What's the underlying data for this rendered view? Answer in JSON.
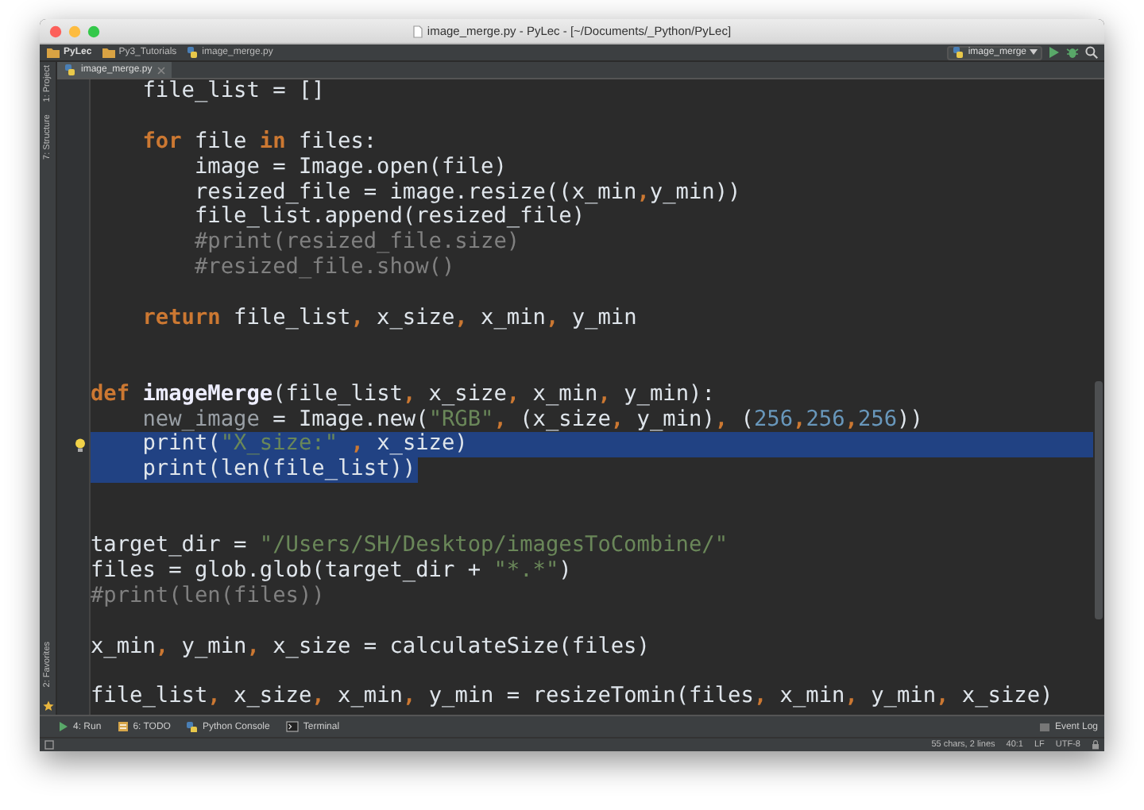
{
  "window": {
    "title": "image_merge.py - PyLec - [~/Documents/_Python/PyLec]"
  },
  "navbar": {
    "breadcrumbs": [
      {
        "label": "PyLec",
        "kind": "folder"
      },
      {
        "label": "Py3_Tutorials",
        "kind": "folder"
      },
      {
        "label": "image_merge.py",
        "kind": "file"
      }
    ],
    "run_config": "image_merge"
  },
  "editor_tabs": [
    {
      "label": "image_merge.py",
      "selected": true
    }
  ],
  "left_tools": {
    "top": [
      "1: Project",
      "7: Structure"
    ],
    "bottom": [
      "2: Favorites"
    ]
  },
  "code": {
    "lines": [
      {
        "selected": false,
        "tokens": [
          {
            "kind": "plain",
            "text": "    file_list = []"
          }
        ]
      },
      {
        "selected": false
      },
      {
        "selected": false,
        "tokens": [
          {
            "kind": "kw",
            "text": "    for"
          },
          {
            "kind": "plain",
            "text": " file "
          },
          {
            "kind": "kw",
            "text": "in"
          },
          {
            "kind": "plain",
            "text": " files:"
          }
        ]
      },
      {
        "selected": false,
        "tokens": [
          {
            "kind": "plain",
            "text": "        image = Image.open(file)"
          }
        ]
      },
      {
        "selected": false,
        "tokens": [
          {
            "kind": "plain",
            "text": "        resized_file = image.resize((x_min"
          },
          {
            "kind": "punct",
            "text": ","
          },
          {
            "kind": "plain",
            "text": "y_min))"
          }
        ]
      },
      {
        "selected": false,
        "tokens": [
          {
            "kind": "plain",
            "text": "        file_list.append(resized_file)"
          }
        ]
      },
      {
        "selected": false,
        "tokens": [
          {
            "kind": "cmt",
            "text": "        #print(resized_file.size)"
          }
        ]
      },
      {
        "selected": false,
        "tokens": [
          {
            "kind": "cmt",
            "text": "        #resized_file.show()"
          }
        ]
      },
      {
        "selected": false
      },
      {
        "selected": false,
        "tokens": [
          {
            "kind": "kw",
            "text": "    return"
          },
          {
            "kind": "plain",
            "text": " file_list"
          },
          {
            "kind": "punct",
            "text": ","
          },
          {
            "kind": "plain",
            "text": " x_size"
          },
          {
            "kind": "punct",
            "text": ","
          },
          {
            "kind": "plain",
            "text": " x_min"
          },
          {
            "kind": "punct",
            "text": ","
          },
          {
            "kind": "plain",
            "text": " y_min"
          }
        ]
      },
      {
        "selected": false
      },
      {
        "selected": false
      },
      {
        "selected": false,
        "tokens": [
          {
            "kind": "kw",
            "text": "def"
          },
          {
            "kind": "fn",
            "text": " imageMerge"
          },
          {
            "kind": "plain",
            "text": "(file_list"
          },
          {
            "kind": "punct",
            "text": ","
          },
          {
            "kind": "plain",
            "text": " x_size"
          },
          {
            "kind": "punct",
            "text": ","
          },
          {
            "kind": "plain",
            "text": " x_min"
          },
          {
            "kind": "punct",
            "text": ","
          },
          {
            "kind": "plain",
            "text": " y_min):"
          }
        ]
      },
      {
        "selected": false,
        "tokens": [
          {
            "kind": "unused",
            "text": "    new_image"
          },
          {
            "kind": "plain",
            "text": " = Image.new("
          },
          {
            "kind": "str",
            "text": "\"RGB\""
          },
          {
            "kind": "punct",
            "text": ","
          },
          {
            "kind": "plain",
            "text": " (x_size"
          },
          {
            "kind": "punct",
            "text": ","
          },
          {
            "kind": "plain",
            "text": " y_min)"
          },
          {
            "kind": "punct",
            "text": ","
          },
          {
            "kind": "plain",
            "text": " ("
          },
          {
            "kind": "num",
            "text": "256"
          },
          {
            "kind": "punct",
            "text": ","
          },
          {
            "kind": "num",
            "text": "256"
          },
          {
            "kind": "punct",
            "text": ","
          },
          {
            "kind": "num",
            "text": "256"
          },
          {
            "kind": "plain",
            "text": "))"
          }
        ]
      },
      {
        "selected": true,
        "tokens": [
          {
            "kind": "plain",
            "text": "    print("
          },
          {
            "kind": "str",
            "text": "\"X_size:\""
          },
          {
            "kind": "punct",
            "text": " ,"
          },
          {
            "kind": "plain",
            "text": " x_size)"
          }
        ]
      },
      {
        "selected": true,
        "tokens": [
          {
            "kind": "plain",
            "text": "    print(len(file_list))"
          }
        ]
      },
      {
        "selected": false
      },
      {
        "selected": false
      },
      {
        "selected": false,
        "tokens": [
          {
            "kind": "plain",
            "text": "target_dir = "
          },
          {
            "kind": "str",
            "text": "\"/Users/SH/Desktop/imagesToCombine/\""
          }
        ]
      },
      {
        "selected": false,
        "tokens": [
          {
            "kind": "plain",
            "text": "files = glob.glob(target_dir + "
          },
          {
            "kind": "str",
            "text": "\"*.*\""
          },
          {
            "kind": "plain",
            "text": ")"
          }
        ]
      },
      {
        "selected": false,
        "tokens": [
          {
            "kind": "cmt",
            "text": "#print(len(files))"
          }
        ]
      },
      {
        "selected": false
      },
      {
        "selected": false,
        "tokens": [
          {
            "kind": "plain",
            "text": "x_min"
          },
          {
            "kind": "punct",
            "text": ","
          },
          {
            "kind": "plain",
            "text": " y_min"
          },
          {
            "kind": "punct",
            "text": ","
          },
          {
            "kind": "plain",
            "text": " x_size = calculateSize(files)"
          }
        ]
      },
      {
        "selected": false
      },
      {
        "selected": false,
        "tokens": [
          {
            "kind": "plain",
            "text": "file_list"
          },
          {
            "kind": "punct",
            "text": ","
          },
          {
            "kind": "plain",
            "text": " x_size"
          },
          {
            "kind": "punct",
            "text": ","
          },
          {
            "kind": "plain",
            "text": " x_min"
          },
          {
            "kind": "punct",
            "text": ","
          },
          {
            "kind": "plain",
            "text": " y_min = resizeTomin(files"
          },
          {
            "kind": "punct",
            "text": ","
          },
          {
            "kind": "plain",
            "text": " x_min"
          },
          {
            "kind": "punct",
            "text": ","
          },
          {
            "kind": "plain",
            "text": " y_min"
          },
          {
            "kind": "punct",
            "text": ","
          },
          {
            "kind": "plain",
            "text": " x_size)"
          }
        ]
      }
    ]
  },
  "tool_windows": [
    {
      "label": "4: Run",
      "kind": "run"
    },
    {
      "label": "6: TODO",
      "kind": "todo"
    },
    {
      "label": "Python Console",
      "kind": "console"
    },
    {
      "label": "Terminal",
      "kind": "terminal"
    }
  ],
  "event_log": "Event Log",
  "status_bar": {
    "selection": "55 chars, 2 lines",
    "position": "40:1",
    "line_separator": "LF",
    "encoding": "UTF-8"
  }
}
